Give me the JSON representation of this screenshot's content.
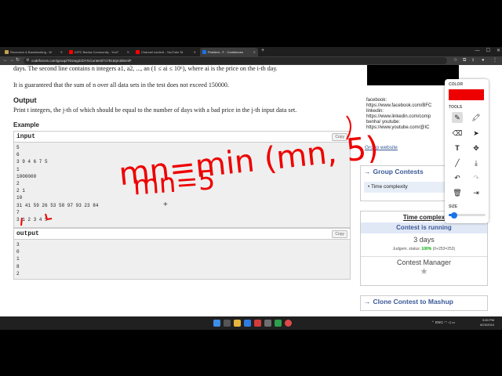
{
  "browser": {
    "tabs": [
      {
        "label": "Recursion & Backtracking - W",
        "favicon_color": "#c5a24a"
      },
      {
        "label": "ICPC Banha Community - YouT",
        "favicon_color": "#ff0000"
      },
      {
        "label": "Channel content - YouTube St",
        "favicon_color": "#ff0000"
      },
      {
        "label": "Problem - F - Codeforces",
        "favicon_color": "#1a73e8"
      }
    ],
    "new_tab": "+",
    "url": "codeforces.com/group/TDzwg2zDYG/contest/717815/problem/F"
  },
  "problem": {
    "line_partial": "days. The second line contains n integers a1, a2, ..., an (1 ≤ ai ≤ 10⁶), where ai is the price on the i-th day.",
    "guarantee": "It is guaranteed that the sum of n over all data sets in the test does not exceed 150000.",
    "output_title": "Output",
    "output_text": "Print t integers, the j-th of which should be equal to the number of days with a bad price in the j-th input data set.",
    "example_title": "Example",
    "input_label": "input",
    "output_label": "output",
    "copy_label": "Copy",
    "input_lines": [
      "5",
      "6",
      "3 9 4 6 7 5",
      "1",
      "1000000",
      "2",
      "2 1",
      "10",
      "31 41 59 26 53 58 97 93 23 84",
      "7",
      "3 1 2 3 4 5"
    ],
    "output_lines": [
      "3",
      "0",
      "1",
      "8",
      "2"
    ]
  },
  "sidebar": {
    "links_lines": [
      "facebook:",
      "https://www.facebook.com/BFC",
      "linkedin:",
      "https://www.linkedin.com/comp",
      "benha/ youtube:",
      "https://www.youtube.com/@IC",
      "nity"
    ],
    "group_website": "Group website",
    "group_contests_title": "Group Contests",
    "group_contests_item": "Time complexity",
    "contest_title": "Time complex",
    "contest_status": "Contest is running",
    "contest_duration": "3 days",
    "judgem_prefix": "Judgem. status: ",
    "judgem_pct": "100%",
    "judgem_count": "(0+253=253)",
    "contest_manager": "Contest Manager",
    "clone_title": "Clone Contest to Mashup"
  },
  "drawing_tool": {
    "color_label": "COLOR",
    "tools_label": "TOOLS",
    "size_label": "SIZE",
    "selected_color": "#ee0000",
    "size_level": 0.15,
    "selected_tool": "pen"
  },
  "annotations": {
    "line1": "mn=min (mn, 5)",
    "line2": "mn=5"
  },
  "taskbar": {
    "lang": "ENG",
    "time": "5:50 PM",
    "date": "8/23/2024"
  }
}
